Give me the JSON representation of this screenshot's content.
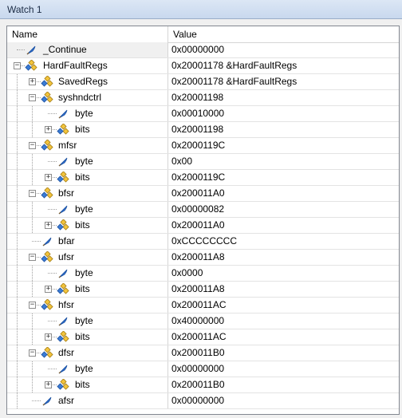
{
  "window": {
    "title": "Watch 1"
  },
  "columns": {
    "name": "Name",
    "value": "Value"
  },
  "rows": [
    {
      "name": "_Continue",
      "value": "0x00000000",
      "level": 0,
      "expander": "none",
      "icon": "field-icon"
    },
    {
      "name": "HardFaultRegs",
      "value": "0x20001178 &HardFaultRegs",
      "level": 0,
      "expander": "minus",
      "icon": "struct-icon"
    },
    {
      "name": "SavedRegs",
      "value": "0x20001178 &HardFaultRegs",
      "level": 1,
      "expander": "plus",
      "icon": "struct-icon"
    },
    {
      "name": "syshndctrl",
      "value": "0x20001198",
      "level": 1,
      "expander": "minus",
      "icon": "struct-icon"
    },
    {
      "name": "byte",
      "value": "0x00010000",
      "level": 2,
      "expander": "none",
      "icon": "field-icon"
    },
    {
      "name": "bits",
      "value": "0x20001198",
      "level": 2,
      "expander": "plus",
      "icon": "struct-icon"
    },
    {
      "name": "mfsr",
      "value": "0x2000119C",
      "level": 1,
      "expander": "minus",
      "icon": "struct-icon"
    },
    {
      "name": "byte",
      "value": "0x00",
      "level": 2,
      "expander": "none",
      "icon": "field-icon"
    },
    {
      "name": "bits",
      "value": "0x2000119C",
      "level": 2,
      "expander": "plus",
      "icon": "struct-icon"
    },
    {
      "name": "bfsr",
      "value": "0x200011A0",
      "level": 1,
      "expander": "minus",
      "icon": "struct-icon"
    },
    {
      "name": "byte",
      "value": "0x00000082",
      "level": 2,
      "expander": "none",
      "icon": "field-icon"
    },
    {
      "name": "bits",
      "value": "0x200011A0",
      "level": 2,
      "expander": "plus",
      "icon": "struct-icon"
    },
    {
      "name": "bfar",
      "value": "0xCCCCCCCC",
      "level": 1,
      "expander": "none",
      "icon": "field-icon"
    },
    {
      "name": "ufsr",
      "value": "0x200011A8",
      "level": 1,
      "expander": "minus",
      "icon": "struct-icon"
    },
    {
      "name": "byte",
      "value": "0x0000",
      "level": 2,
      "expander": "none",
      "icon": "field-icon"
    },
    {
      "name": "bits",
      "value": "0x200011A8",
      "level": 2,
      "expander": "plus",
      "icon": "struct-icon"
    },
    {
      "name": "hfsr",
      "value": "0x200011AC",
      "level": 1,
      "expander": "minus",
      "icon": "struct-icon"
    },
    {
      "name": "byte",
      "value": "0x40000000",
      "level": 2,
      "expander": "none",
      "icon": "field-icon"
    },
    {
      "name": "bits",
      "value": "0x200011AC",
      "level": 2,
      "expander": "plus",
      "icon": "struct-icon"
    },
    {
      "name": "dfsr",
      "value": "0x200011B0",
      "level": 1,
      "expander": "minus",
      "icon": "struct-icon"
    },
    {
      "name": "byte",
      "value": "0x00000000",
      "level": 2,
      "expander": "none",
      "icon": "field-icon"
    },
    {
      "name": "bits",
      "value": "0x200011B0",
      "level": 2,
      "expander": "plus",
      "icon": "struct-icon"
    },
    {
      "name": "afsr",
      "value": "0x00000000",
      "level": 1,
      "expander": "none",
      "icon": "field-icon"
    }
  ]
}
